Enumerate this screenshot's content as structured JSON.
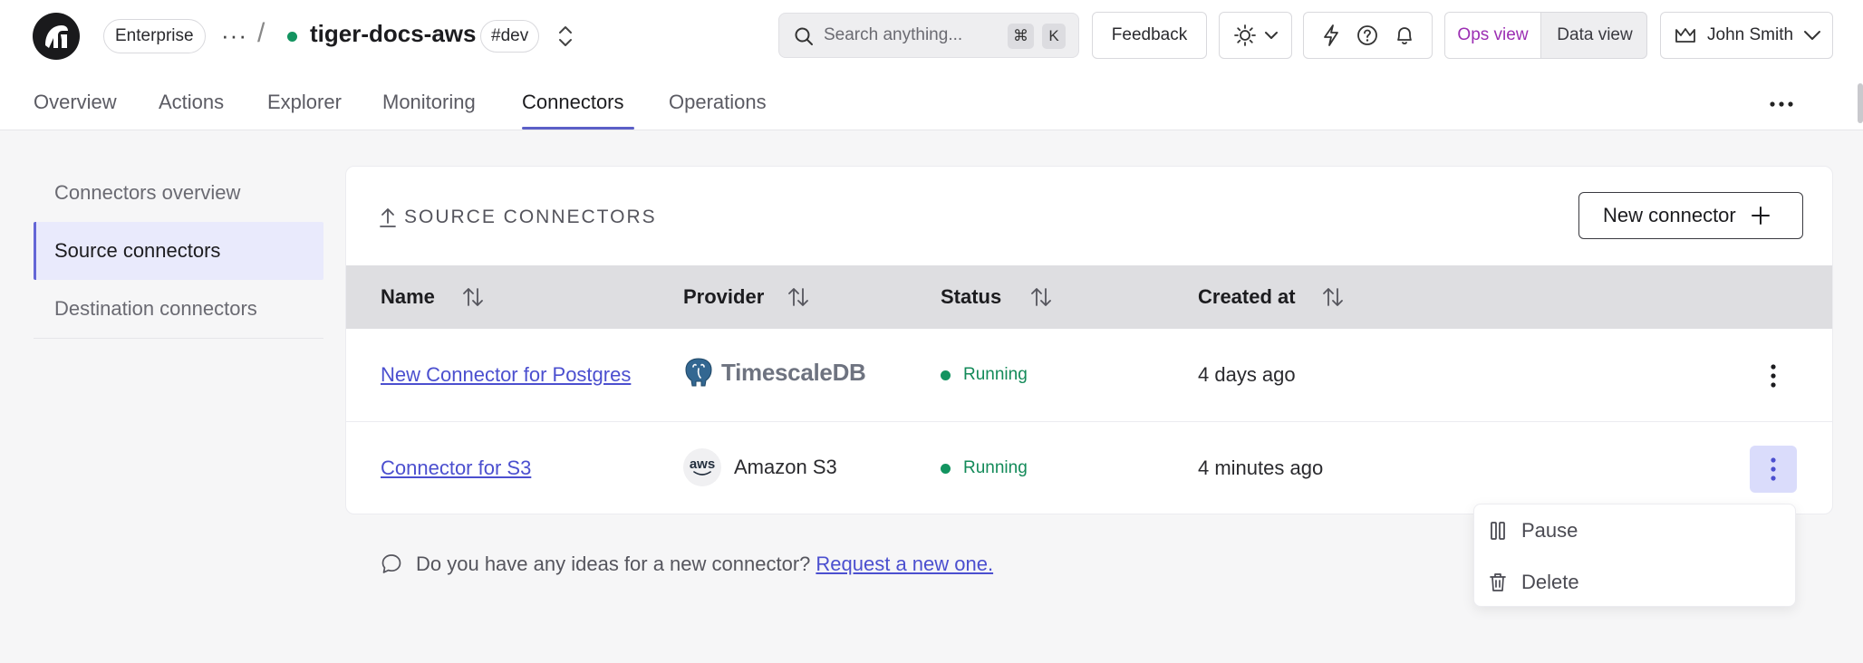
{
  "header": {
    "plan_badge": "Enterprise",
    "project_name": "tiger-docs-aws",
    "env_badge": "#dev",
    "search_placeholder": "Search anything...",
    "search_shortcut_mod": "⌘",
    "search_shortcut_key": "K",
    "feedback_label": "Feedback",
    "ops_view_label": "Ops view",
    "data_view_label": "Data view",
    "user_name": "John Smith"
  },
  "tabs": [
    {
      "label": "Overview"
    },
    {
      "label": "Actions"
    },
    {
      "label": "Explorer"
    },
    {
      "label": "Monitoring"
    },
    {
      "label": "Connectors"
    },
    {
      "label": "Operations"
    }
  ],
  "sidebar": {
    "items": [
      {
        "label": "Connectors overview"
      },
      {
        "label": "Source connectors"
      },
      {
        "label": "Destination connectors"
      }
    ]
  },
  "panel": {
    "title": "SOURCE CONNECTORS",
    "new_button_label": "New connector",
    "columns": [
      "Name",
      "Provider",
      "Status",
      "Created at"
    ],
    "rows": [
      {
        "name": "New Connector for Postgres",
        "provider": "TimescaleDB",
        "status": "Running",
        "created": "4 days ago"
      },
      {
        "name": "Connector for S3",
        "provider": "Amazon S3",
        "provider_logo_text": "aws",
        "status": "Running",
        "created": "4 minutes ago"
      }
    ]
  },
  "footer_note": {
    "text": "Do you have any ideas for a new connector?",
    "link": "Request a new one."
  },
  "row_menu": {
    "items": [
      {
        "label": "Pause"
      },
      {
        "label": "Delete"
      }
    ]
  },
  "colors": {
    "accent": "#5b5fc7",
    "link": "#4b4fcf",
    "status_running": "#139460",
    "ops_view_active": "#9c2fb3"
  }
}
